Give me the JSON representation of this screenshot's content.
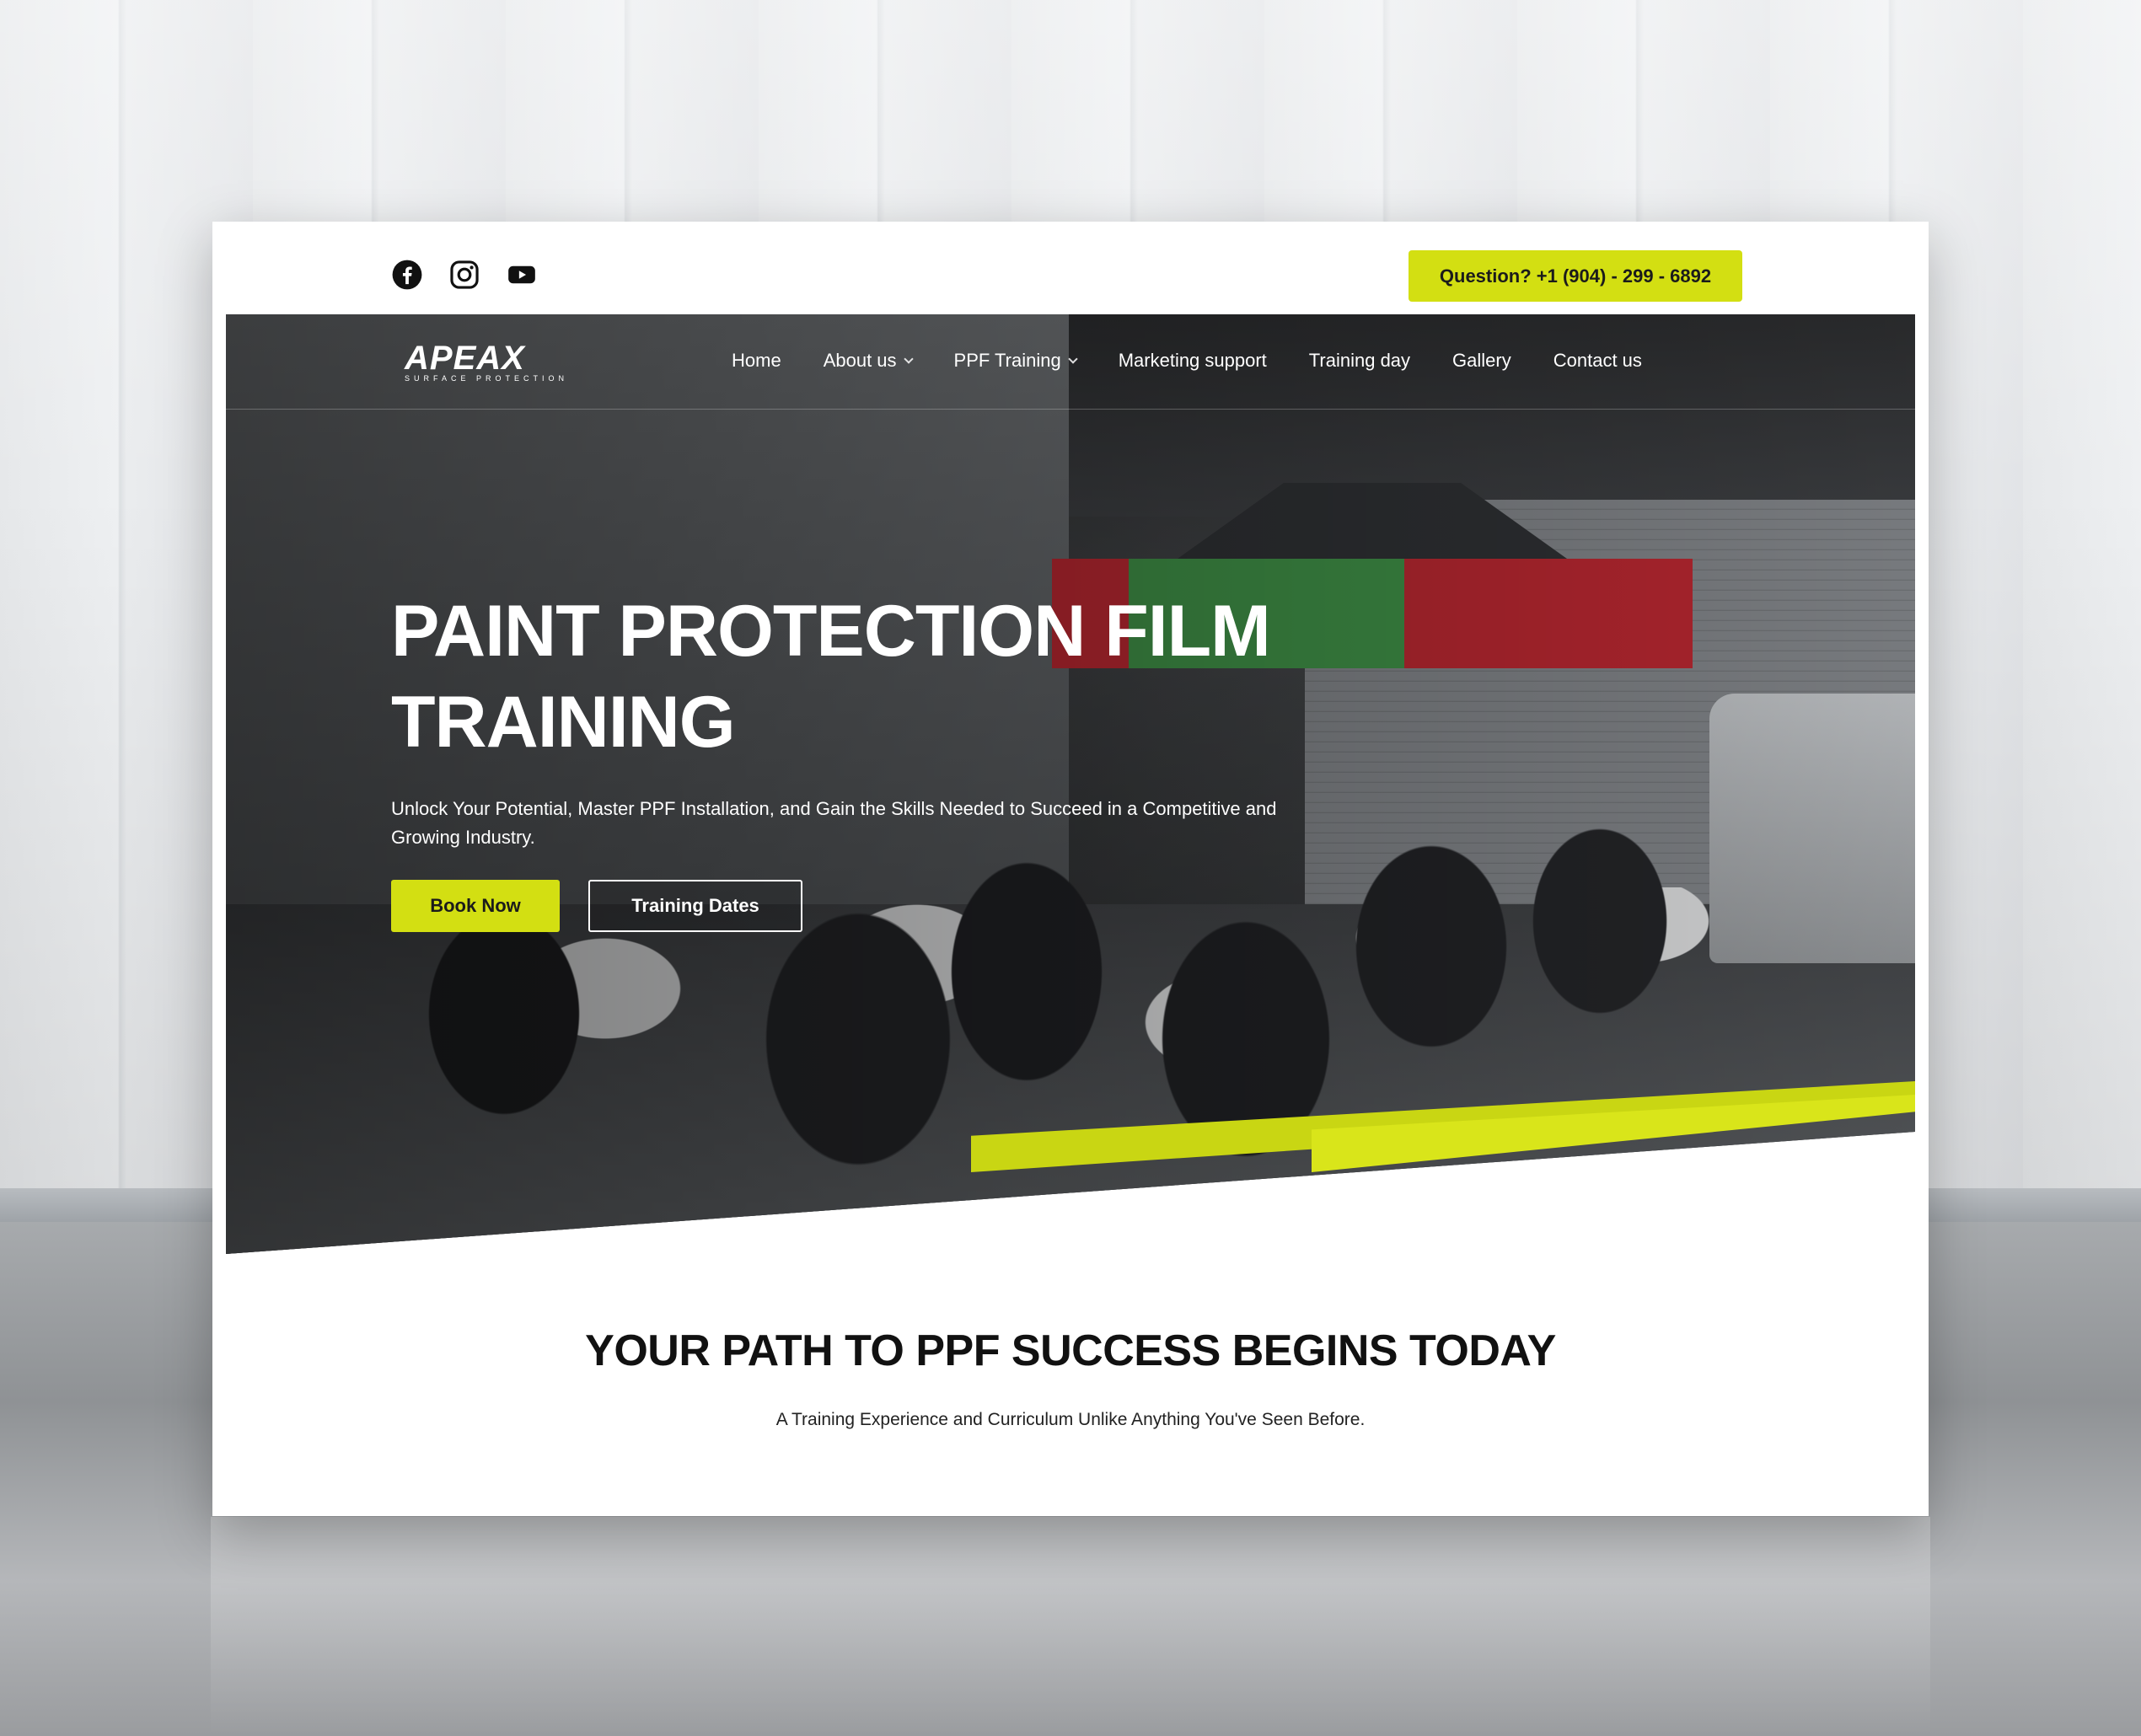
{
  "topbar": {
    "social": [
      {
        "icon": "facebook-icon"
      },
      {
        "icon": "instagram-icon"
      },
      {
        "icon": "youtube-icon"
      }
    ],
    "phone_label": "Question? +1 (904) - 299 - 6892"
  },
  "brand": {
    "logo_text": "APEAX",
    "logo_sub": "SURFACE PROTECTION"
  },
  "nav": {
    "items": [
      {
        "label": "Home",
        "has_dropdown": false
      },
      {
        "label": "About us",
        "has_dropdown": true
      },
      {
        "label": "PPF Training",
        "has_dropdown": true
      },
      {
        "label": "Marketing support",
        "has_dropdown": false
      },
      {
        "label": "Training day",
        "has_dropdown": false
      },
      {
        "label": "Gallery",
        "has_dropdown": false
      },
      {
        "label": "Contact us",
        "has_dropdown": false
      }
    ]
  },
  "hero": {
    "title_line1": "PAINT PROTECTION FILM",
    "title_line2": "TRAINING",
    "subtitle": "Unlock Your Potential, Master PPF Installation, and Gain the Skills Needed to Succeed in a Competitive and Growing Industry.",
    "primary_button": "Book Now",
    "secondary_button": "Training Dates"
  },
  "intro": {
    "title": "YOUR PATH TO PPF SUCCESS BEGINS TODAY",
    "subtitle": "A Training Experience and Curriculum Unlike Anything You've Seen Before."
  },
  "colors": {
    "accent": "#d3df12",
    "text_dark": "#111111",
    "white": "#ffffff"
  }
}
